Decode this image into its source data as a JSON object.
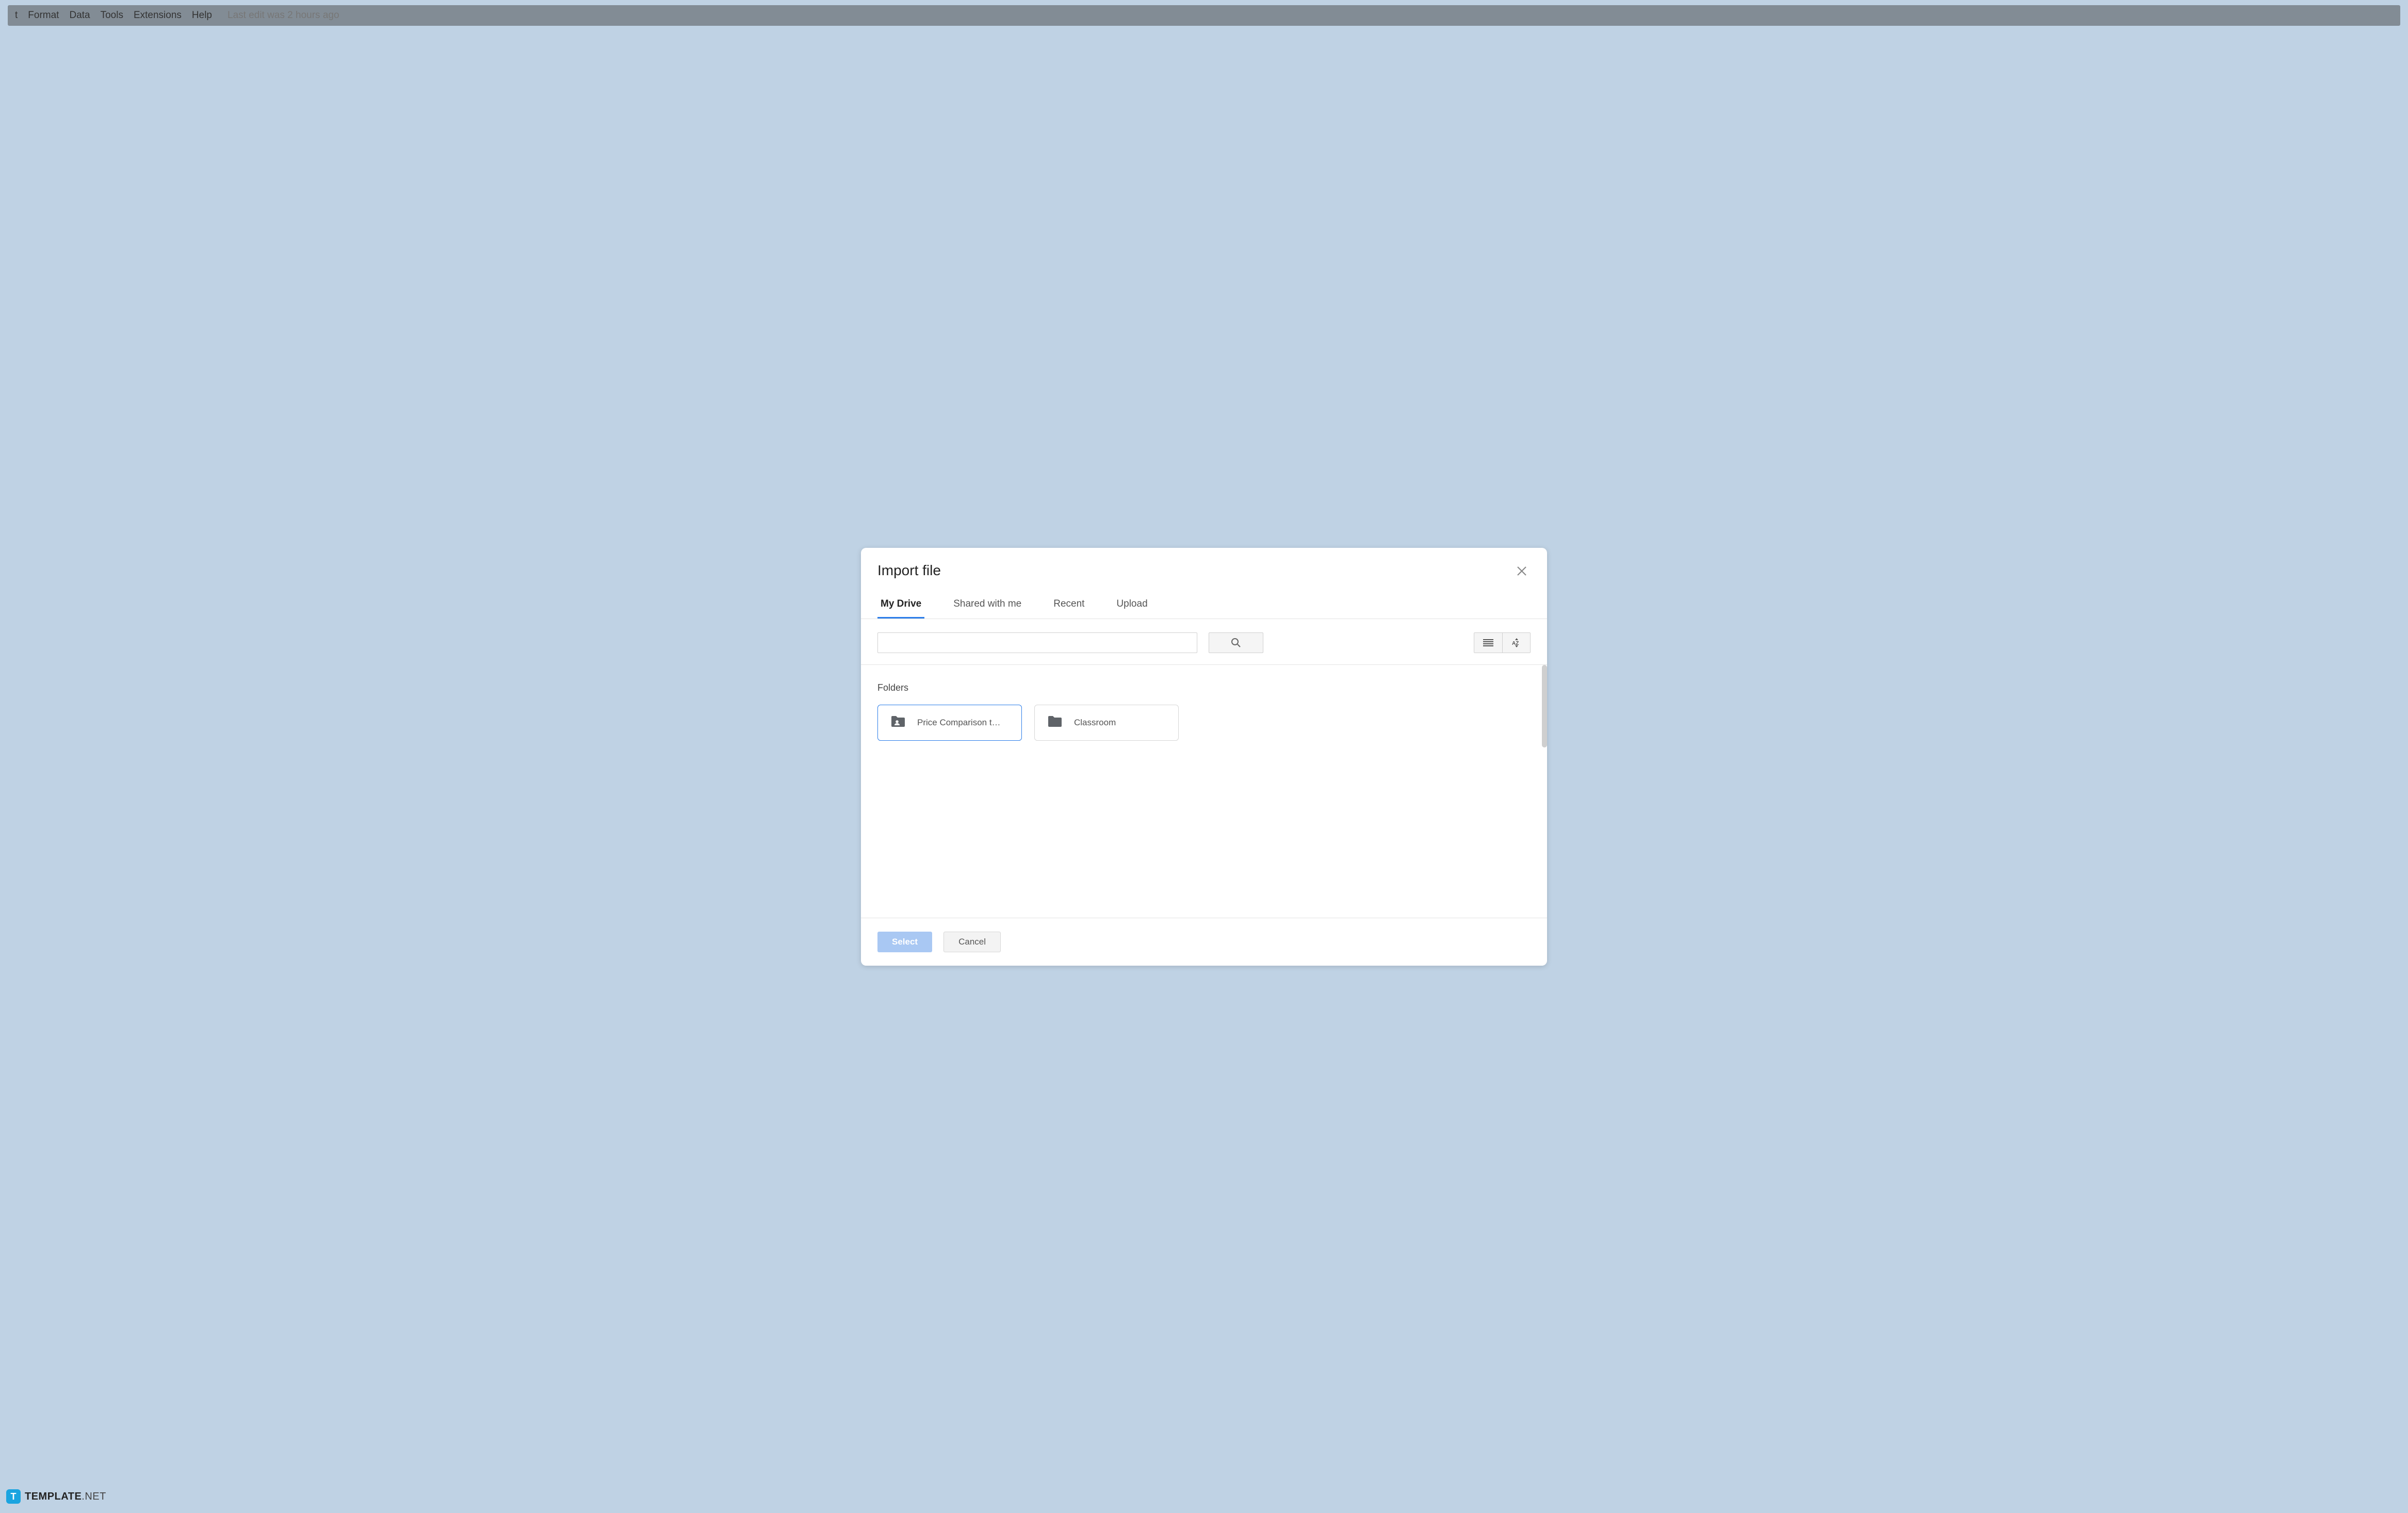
{
  "background_menu": {
    "items": [
      "t",
      "Format",
      "Data",
      "Tools",
      "Extensions",
      "Help"
    ],
    "last_edit": "Last edit was 2 hours ago"
  },
  "dialog": {
    "title": "Import file",
    "tabs": [
      {
        "label": "My Drive",
        "active": true
      },
      {
        "label": "Shared with me",
        "active": false
      },
      {
        "label": "Recent",
        "active": false
      },
      {
        "label": "Upload",
        "active": false
      }
    ],
    "search": {
      "value": ""
    },
    "section_label": "Folders",
    "folders": [
      {
        "name": "Price Comparison t…",
        "shared": true,
        "selected": true
      },
      {
        "name": "Classroom",
        "shared": false,
        "selected": false
      }
    ],
    "buttons": {
      "select": "Select",
      "cancel": "Cancel"
    }
  },
  "watermark": {
    "badge": "T",
    "brand": "TEMPLATE",
    "suffix": ".NET"
  }
}
